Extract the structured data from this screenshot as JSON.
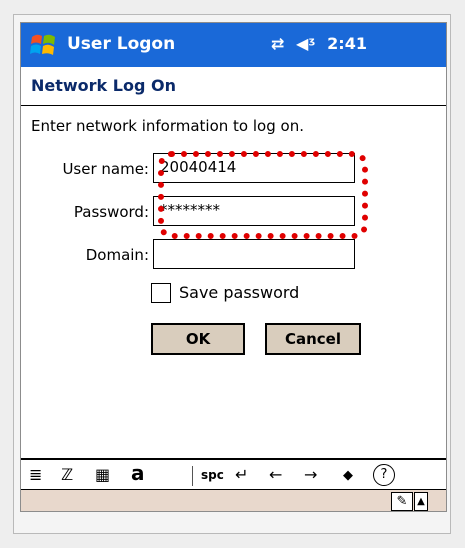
{
  "titlebar": {
    "app_title": "User Logon",
    "connectivity_icon": "connectivity-icon",
    "volume_icon": "speaker-icon",
    "clock": "2:41"
  },
  "header": {
    "title": "Network Log On"
  },
  "form": {
    "instructions": "Enter network information to log on.",
    "username_label": "User name:",
    "username_value": "20040414",
    "password_label": "Password:",
    "password_value": "********",
    "domain_label": "Domain:",
    "domain_value": "",
    "save_password_label": "Save password",
    "save_password_checked": false,
    "ok_label": "OK",
    "cancel_label": "Cancel"
  },
  "input_panel": {
    "keys": [
      "≣",
      "ℤ",
      "▦",
      "a",
      "spc",
      "↵",
      "←",
      "→",
      "◆",
      "?"
    ]
  },
  "colors": {
    "titlebar": "#1a69d8",
    "header_text": "#0b2a6a",
    "button_bg": "#d9cdbd",
    "highlight": "#e00000",
    "menubar": "#e8d8cc"
  }
}
